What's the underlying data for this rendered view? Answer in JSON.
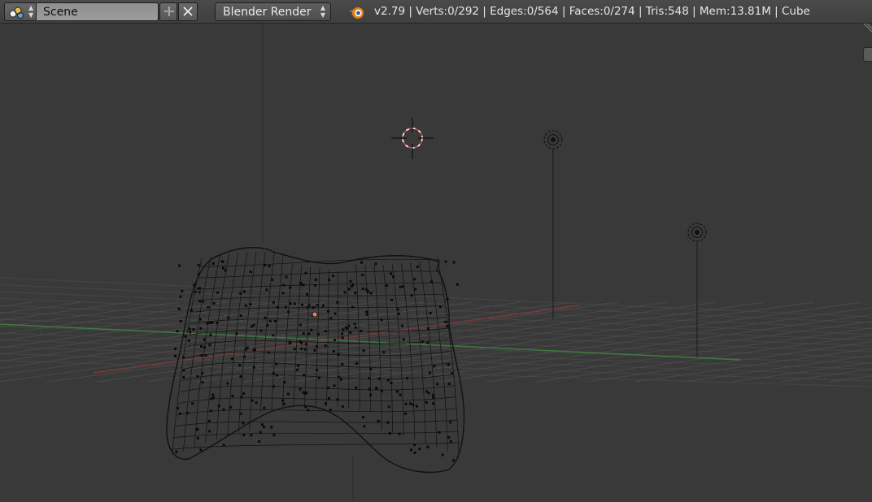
{
  "header": {
    "screen_type_icon": "scene-icon",
    "scene_name": "Scene",
    "add_icon": "plus-icon",
    "remove_icon": "x-icon",
    "render_engine": "Blender Render",
    "logo_icon": "blender-logo-icon",
    "stats": "v2.79 | Verts:0/292 | Edges:0/564 | Faces:0/274 | Tris:548 | Mem:13.81M | Cube"
  },
  "viewport": {
    "objects": [
      "cube-mesh-wireframe",
      "3d-cursor",
      "lamp",
      "lamp"
    ],
    "colors": {
      "background": "#393939",
      "grid": "#4f4f4f",
      "x_axis": "#7a3b3b",
      "y_axis": "#3e7a3e",
      "wire": "#111111",
      "cursor_ring": "#d04040",
      "origin": "#e08060"
    }
  }
}
